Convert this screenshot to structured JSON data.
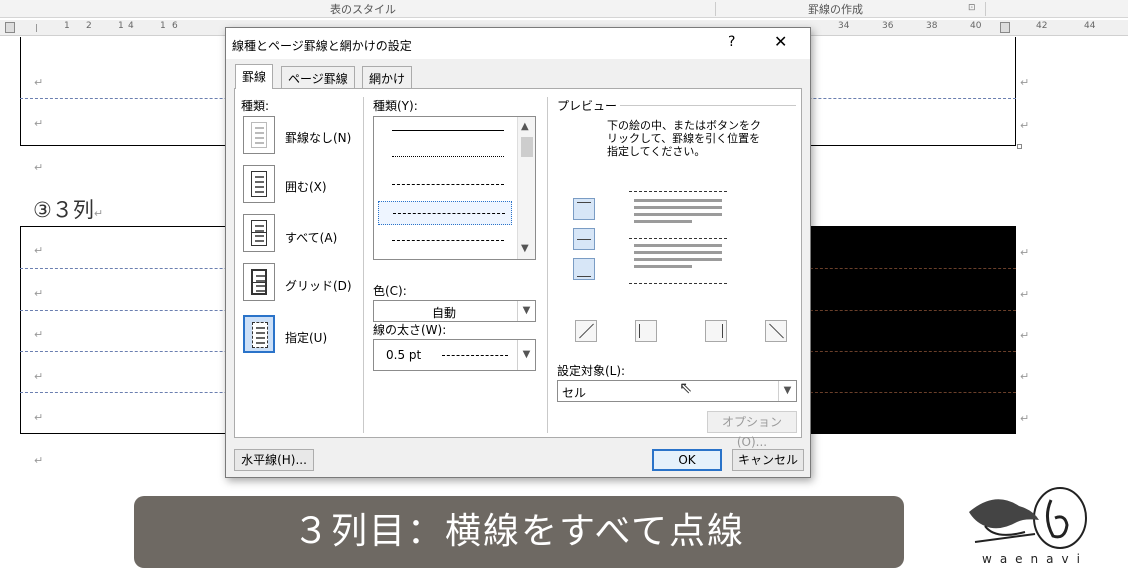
{
  "ribbon": {
    "table_styles_label": "表のスタイル",
    "borders_label": "罫線の作成",
    "launcher_icon": "dialog-launcher-icon"
  },
  "ruler": {
    "left_nums": [
      "1",
      "2",
      "1",
      "4",
      "1",
      "6"
    ],
    "right_nums": [
      "34",
      "36",
      "38",
      "40",
      "42",
      "44"
    ]
  },
  "document": {
    "heading": "③３列",
    "paragraph_mark": "↵",
    "table2_black_color": "#000000"
  },
  "dialog": {
    "title": "線種とページ罫線と網かけの設定",
    "help": "?",
    "close": "✕",
    "tabs": [
      {
        "label": "罫線",
        "active": true
      },
      {
        "label": "ページ罫線",
        "active": false
      },
      {
        "label": "網かけ",
        "active": false
      }
    ],
    "settings_label": "種類:",
    "settings": [
      {
        "label": "罫線なし(N)",
        "selected": false
      },
      {
        "label": "囲む(X)",
        "selected": false
      },
      {
        "label": "すべて(A)",
        "selected": false
      },
      {
        "label": "グリッド(D)",
        "selected": false
      },
      {
        "label": "指定(U)",
        "selected": true
      }
    ],
    "style_label": "種類(Y):",
    "style_options": [
      "solid",
      "dotted",
      "fine-dash",
      "dash",
      "dash-dot"
    ],
    "style_selected_index": 3,
    "color_label": "色(C):",
    "color_value": "自動",
    "width_label": "線の太さ(W):",
    "width_value": "0.5 pt",
    "preview_label": "プレビュー",
    "preview_instruction": "下の絵の中、またはボタンをクリックして、罫線を引く位置を指定してください。",
    "apply_label": "設定対象(L):",
    "apply_value": "セル",
    "options_button": "オプション(O)...",
    "horizontal_line_button": "水平線(H)...",
    "ok_button": "OK",
    "cancel_button": "キャンセル",
    "accent_color": "#2a73c9"
  },
  "caption": {
    "text": "３列目：横線をすべて点線"
  },
  "logo": {
    "text": "waenavi",
    "icon": "bird-logo-icon"
  }
}
